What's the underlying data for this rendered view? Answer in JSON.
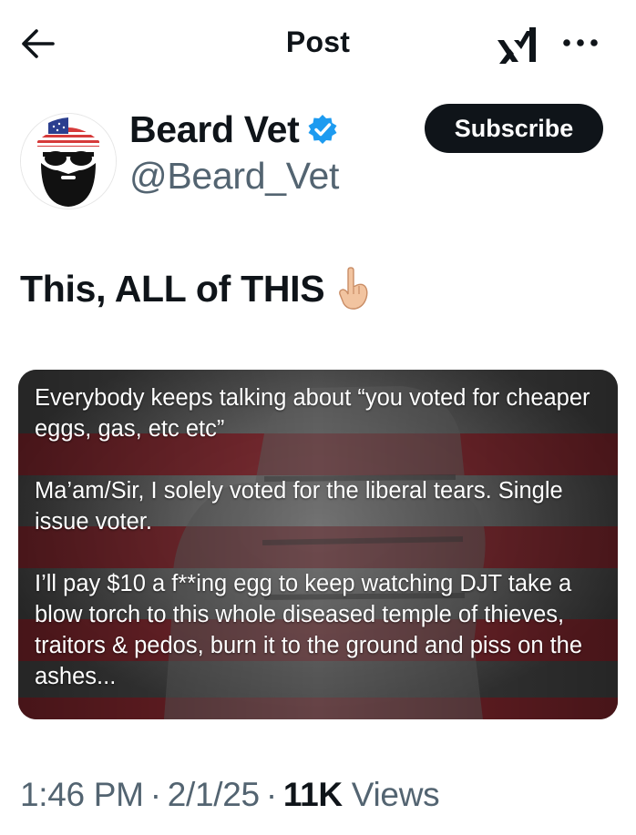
{
  "header": {
    "title": "Post",
    "back_icon": "arrow-left-icon",
    "grok_icon": "grok-icon",
    "more_icon": "more-dots-icon"
  },
  "author": {
    "display_name": "Beard Vet",
    "handle": "@Beard_Vet",
    "verified": true,
    "verified_color": "#1d9bf0",
    "avatar_icon": "bearded-man-flag-bandana-avatar",
    "subscribe_label": "Subscribe"
  },
  "tweet": {
    "text": "This, ALL of THIS",
    "emoji": "backhand-index-pointing-down-emoji"
  },
  "media": {
    "background": "american-flag-over-raised-fist-image",
    "paragraphs": [
      "Everybody keeps talking about “you voted for cheaper eggs, gas, etc etc”",
      "Ma’am/Sir, I solely voted for the liberal tears. Single issue voter.",
      "I’ll pay $10 a f**ing egg to keep watching DJT take a blow torch to this whole diseased temple of thieves, traitors & pedos, burn it to the ground and piss on the ashes..."
    ]
  },
  "meta": {
    "time": "1:46 PM",
    "date": "2/1/25",
    "views_count": "11K",
    "views_label": "Views",
    "separator": "·"
  },
  "colors": {
    "text_primary": "#0f1419",
    "text_secondary": "#536471",
    "button_bg": "#0f1419",
    "flag_red": "#7a1a22"
  }
}
